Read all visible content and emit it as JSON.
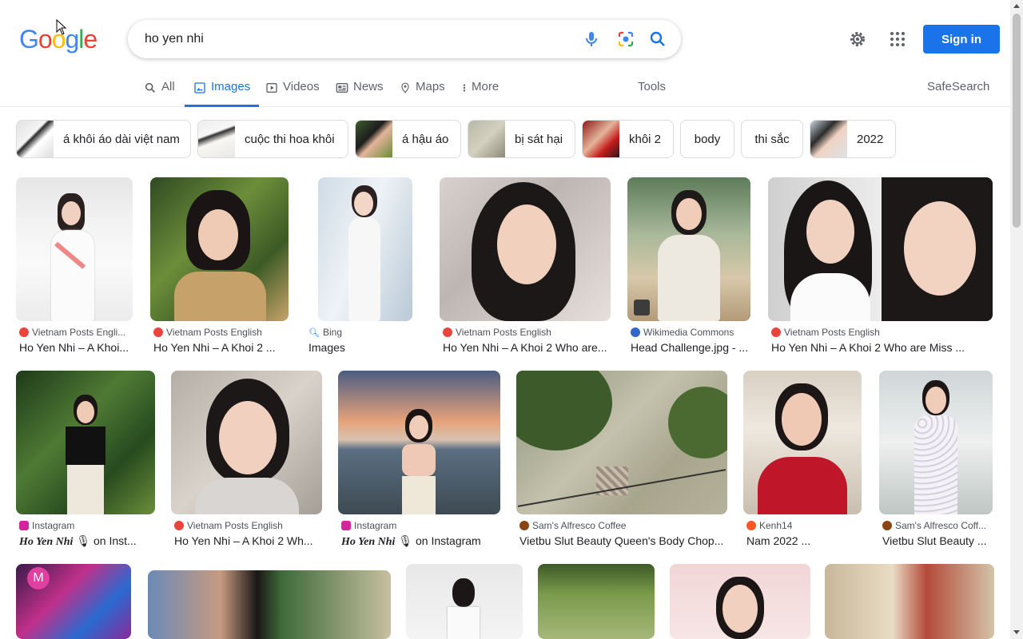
{
  "logo": {
    "text": "Google",
    "letters": [
      "G",
      "o",
      "o",
      "g",
      "l",
      "e"
    ],
    "colors": [
      "#4285f4",
      "#ea4335",
      "#fbbc05",
      "#4285f4",
      "#34a853",
      "#ea4335"
    ]
  },
  "search": {
    "query": "ho yen nhi"
  },
  "header": {
    "signin_label": "Sign in"
  },
  "tabs": [
    {
      "label": "All",
      "icon": "search-icon"
    },
    {
      "label": "Images",
      "icon": "image-icon",
      "active": true
    },
    {
      "label": "Videos",
      "icon": "play-icon"
    },
    {
      "label": "News",
      "icon": "news-icon"
    },
    {
      "label": "Maps",
      "icon": "pin-icon"
    },
    {
      "label": "More",
      "icon": "more-vert-icon"
    }
  ],
  "tools_label": "Tools",
  "safesearch_label": "SafeSearch",
  "chips": [
    {
      "label": "á khôi áo dài việt nam",
      "thumb": true
    },
    {
      "label": "cuộc thi hoa khôi",
      "thumb": true
    },
    {
      "label": "á hậu áo",
      "thumb": true
    },
    {
      "label": "bị sát hại",
      "thumb": true
    },
    {
      "label": "khôi 2",
      "thumb": true
    },
    {
      "label": "body",
      "thumb": false
    },
    {
      "label": "thi sắc",
      "thumb": false
    },
    {
      "label": "2022",
      "thumb": true
    }
  ],
  "results_row1": [
    {
      "source": "Vietnam Posts Engli...",
      "title": "Ho Yen Nhi – A Khoi...",
      "fav": "#e8453c"
    },
    {
      "source": "Vietnam Posts English",
      "title": "Ho Yen Nhi – A Khoi 2 ...",
      "fav": "#e8453c"
    },
    {
      "source": "Bing",
      "title": "Images",
      "fav": "#1a73e8"
    },
    {
      "source": "Vietnam Posts English",
      "title": "Ho Yen Nhi – A Khoi 2 Who are...",
      "fav": "#e8453c"
    },
    {
      "source": "Wikimedia Commons",
      "title": "Head Challenge.jpg - ...",
      "fav": "#3366cc"
    },
    {
      "source": "Vietnam Posts English",
      "title": "Ho Yen Nhi – A Khoi 2 Who are Miss ...",
      "fav": "#e8453c"
    }
  ],
  "results_row2": [
    {
      "source": "Instagram",
      "title_bold": "Ho Yen Nhi",
      "title": "on Inst...",
      "fav": "#d6249f"
    },
    {
      "source": "Vietnam Posts English",
      "title": "Ho Yen Nhi – A Khoi 2 Wh...",
      "fav": "#e8453c"
    },
    {
      "source": "Instagram",
      "title_bold": "Ho Yen Nhi",
      "title": "on Instagram",
      "fav": "#d6249f"
    },
    {
      "source": "Sam's Alfresco Coffee",
      "title": "Vietbu Slut Beauty Queen's Body Chop...",
      "fav": "#8b4513"
    },
    {
      "source": "Kenh14",
      "title": "Nam 2022 ...",
      "fav": "#ff5722"
    },
    {
      "source": "Sam's Alfresco Coff...",
      "title": "Vietbu Slut Beauty ...",
      "fav": "#8b4513"
    }
  ]
}
